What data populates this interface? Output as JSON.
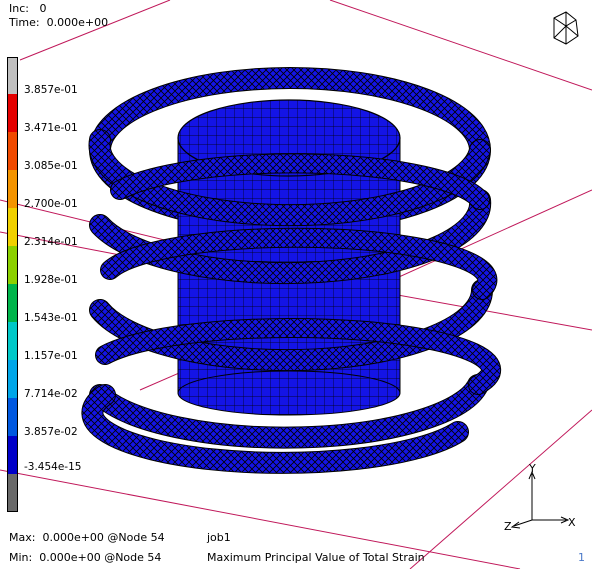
{
  "header": {
    "inc_label": "Inc:",
    "inc_value": "0",
    "time_label": "Time:",
    "time_value": "0.000e+00"
  },
  "legend": {
    "labels": [
      "3.857e-01",
      "3.471e-01",
      "3.085e-01",
      "2.700e-01",
      "2.314e-01",
      "1.928e-01",
      "1.543e-01",
      "1.157e-01",
      "7.714e-02",
      "3.857e-02",
      "-3.454e-15"
    ],
    "colors": {
      "top": "#c0c0c0",
      "c1": "#e40000",
      "c2": "#f04a00",
      "c3": "#f49400",
      "c4": "#f0d000",
      "c5": "#c8d800",
      "c6": "#5ecc00",
      "c7": "#00b44a",
      "c8": "#00c8c8",
      "c9": "#00a6e8",
      "c10": "#0058e0",
      "c11": "#0000c8",
      "bottom": "#6a6a6a"
    }
  },
  "footer": {
    "max_label": "Max:",
    "max_value": "0.000e+00 @Node  54",
    "min_label": "Min:",
    "min_value": "0.000e+00 @Node  54",
    "job_name": "job1",
    "result_title": "Maximum Principal Value of Total Strain",
    "window_index": "1"
  },
  "axes": {
    "y": "Y",
    "x": "X",
    "z": "Z"
  },
  "colors": {
    "model_fill": "#1414e6",
    "model_edge": "#000000",
    "ground_lines": "#c0185a"
  }
}
